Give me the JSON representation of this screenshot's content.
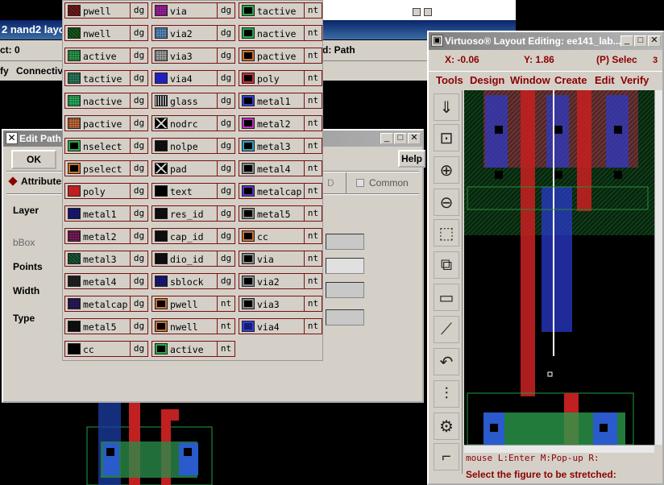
{
  "background_window": {
    "title": "2 nand2 layo",
    "status_left": "ct: 0",
    "status_right": "d: Path",
    "menu": [
      "fy",
      "Connectivi"
    ]
  },
  "edit_path": {
    "title": "Edit Path",
    "ok_label": "OK",
    "help_label": "Help",
    "attributes_tab": "Attributes",
    "tab_partial": "D",
    "common_label": "Common",
    "layer_label": "Layer",
    "bbox_label": "bBox",
    "points_label": "Points",
    "width_label": "Width",
    "type_label": "Type"
  },
  "palette": {
    "columns": [
      [
        {
          "name": "pwell",
          "purpose": "dg",
          "color": "#7a1a1a",
          "pattern": "hatch"
        },
        {
          "name": "nwell",
          "purpose": "dg",
          "color": "#1a5a1a",
          "pattern": "hatch"
        },
        {
          "name": "active",
          "purpose": "dg",
          "color": "#2a9a4a",
          "pattern": "dots"
        },
        {
          "name": "tactive",
          "purpose": "dg",
          "color": "#2a7a5a",
          "pattern": "dots"
        },
        {
          "name": "nactive",
          "purpose": "dg",
          "color": "#2aaa5a",
          "pattern": "dots"
        },
        {
          "name": "pactive",
          "purpose": "dg",
          "color": "#c06a3a",
          "pattern": "dots"
        },
        {
          "name": "nselect",
          "purpose": "dg",
          "color": "#000000",
          "pattern": "outline-green"
        },
        {
          "name": "pselect",
          "purpose": "dg",
          "color": "#000000",
          "pattern": "outline-orange"
        },
        {
          "name": "poly",
          "purpose": "dg",
          "color": "#c02020",
          "pattern": "solid"
        },
        {
          "name": "metal1",
          "purpose": "dg",
          "color": "#1a1a7a",
          "pattern": "dots"
        },
        {
          "name": "metal2",
          "purpose": "dg",
          "color": "#7a1a5a",
          "pattern": "dots"
        },
        {
          "name": "metal3",
          "purpose": "dg",
          "color": "#1a5a3a",
          "pattern": "hatch"
        },
        {
          "name": "metal4",
          "purpose": "dg",
          "color": "#222222",
          "pattern": "dots"
        },
        {
          "name": "metalcap",
          "purpose": "dg",
          "color": "#2a1a5a",
          "pattern": "dots"
        },
        {
          "name": "metal5",
          "purpose": "dg",
          "color": "#111111",
          "pattern": "dots"
        },
        {
          "name": "cc",
          "purpose": "dg",
          "color": "#000000",
          "pattern": "solid"
        }
      ],
      [
        {
          "name": "via",
          "purpose": "dg",
          "color": "#a020a0",
          "pattern": "dots"
        },
        {
          "name": "via2",
          "purpose": "dg",
          "color": "#5a8ac0",
          "pattern": "dots"
        },
        {
          "name": "via3",
          "purpose": "dg",
          "color": "#a0a0a0",
          "pattern": "dots"
        },
        {
          "name": "via4",
          "purpose": "dg",
          "color": "#2020c0",
          "pattern": "solid"
        },
        {
          "name": "glass",
          "purpose": "dg",
          "color": "#222222",
          "pattern": "vlines"
        },
        {
          "name": "nodrc",
          "purpose": "dg",
          "color": "#000000",
          "pattern": "x"
        },
        {
          "name": "nolpe",
          "purpose": "dg",
          "color": "#111111",
          "pattern": "dots"
        },
        {
          "name": "pad",
          "purpose": "dg",
          "color": "#000000",
          "pattern": "x"
        },
        {
          "name": "text",
          "purpose": "dg",
          "color": "#000000",
          "pattern": "solid"
        },
        {
          "name": "res_id",
          "purpose": "dg",
          "color": "#111111",
          "pattern": "dots"
        },
        {
          "name": "cap_id",
          "purpose": "dg",
          "color": "#111111",
          "pattern": "dots"
        },
        {
          "name": "dio_id",
          "purpose": "dg",
          "color": "#111111",
          "pattern": "dots"
        },
        {
          "name": "sblock",
          "purpose": "dg",
          "color": "#1a1a7a",
          "pattern": "dots"
        },
        {
          "name": "pwell",
          "purpose": "nt",
          "color": "#000000",
          "pattern": "outline-orange"
        },
        {
          "name": "nwell",
          "purpose": "nt",
          "color": "#000000",
          "pattern": "outline-orange"
        },
        {
          "name": "active",
          "purpose": "nt",
          "color": "#000000",
          "pattern": "outline-green"
        }
      ],
      [
        {
          "name": "tactive",
          "purpose": "nt",
          "color": "#000000",
          "pattern": "outline-green"
        },
        {
          "name": "nactive",
          "purpose": "nt",
          "color": "#000000",
          "pattern": "outline-green"
        },
        {
          "name": "pactive",
          "purpose": "nt",
          "color": "#000000",
          "pattern": "outline-orange"
        },
        {
          "name": "poly",
          "purpose": "nt",
          "color": "#000000",
          "pattern": "outline-red"
        },
        {
          "name": "metal1",
          "purpose": "nt",
          "color": "#000000",
          "pattern": "outline-blue"
        },
        {
          "name": "metal2",
          "purpose": "nt",
          "color": "#000000",
          "pattern": "outline-magenta"
        },
        {
          "name": "metal3",
          "purpose": "nt",
          "color": "#000000",
          "pattern": "outline-cyan"
        },
        {
          "name": "metal4",
          "purpose": "nt",
          "color": "#000000",
          "pattern": "outline-gray"
        },
        {
          "name": "metalcap",
          "purpose": "nt",
          "color": "#000000",
          "pattern": "outline-purple"
        },
        {
          "name": "metal5",
          "purpose": "nt",
          "color": "#000000",
          "pattern": "outline-gray"
        },
        {
          "name": "cc",
          "purpose": "nt",
          "color": "#000000",
          "pattern": "outline-orange"
        },
        {
          "name": "via",
          "purpose": "nt",
          "color": "#000000",
          "pattern": "outline-gray"
        },
        {
          "name": "via2",
          "purpose": "nt",
          "color": "#000000",
          "pattern": "outline-gray"
        },
        {
          "name": "via3",
          "purpose": "nt",
          "color": "#000000",
          "pattern": "outline-gray"
        },
        {
          "name": "via4",
          "purpose": "nt",
          "color": "#1a1a7a",
          "pattern": "outline-blue"
        }
      ]
    ]
  },
  "virtuoso": {
    "title": "Virtuoso® Layout Editing: ee141_lab...",
    "x_coord": "X: -0.06",
    "y_coord": "Y: 1.86",
    "select_info": "(P) Selec",
    "select_count": "3",
    "menu": [
      "Tools",
      "Design",
      "Window",
      "Create",
      "Edit",
      "Verify"
    ],
    "tools": [
      "stretch-icon",
      "zoom-fit-icon",
      "zoom-in-icon",
      "zoom-out-icon",
      "select-icon",
      "copy-icon",
      "stretch-box-icon",
      "path-icon",
      "undo-icon",
      "properties-icon",
      "hierarchy-icon",
      "route-icon"
    ],
    "mouse_hint": "mouse L:Enter   M:Pop-up R:",
    "prompt": "Select the figure to be stretched:"
  }
}
